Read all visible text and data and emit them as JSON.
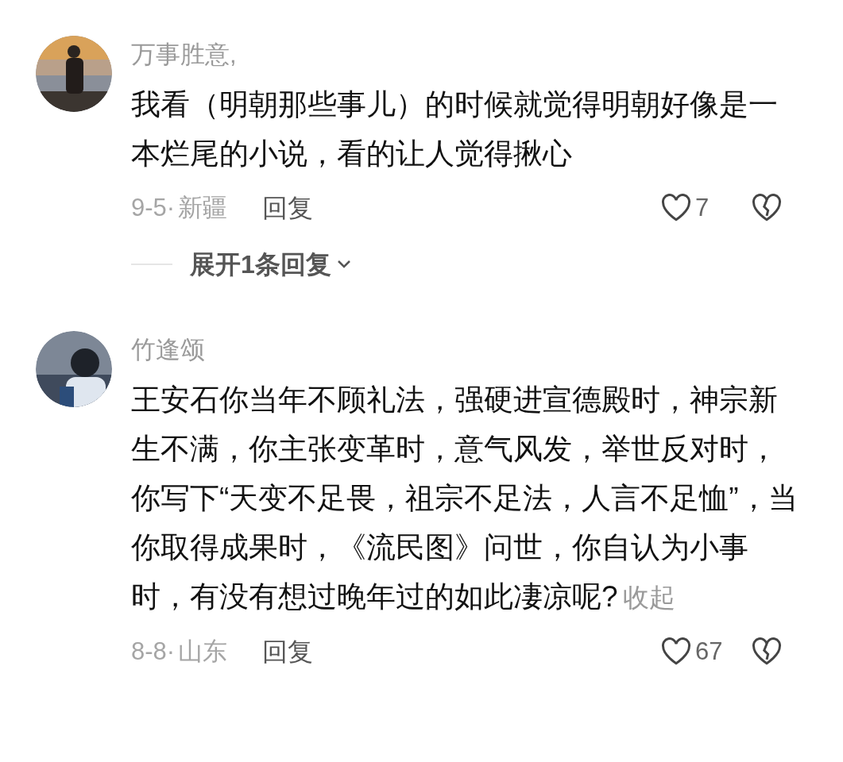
{
  "comments": [
    {
      "author": "万事胜意,",
      "text": "我看（明朝那些事儿）的时候就觉得明朝好像是一本烂尾的小说，看的让人觉得揪心",
      "date": "9-5·",
      "location": "新疆",
      "reply": "回复",
      "likes": "7",
      "expand_replies": "展开1条回复"
    },
    {
      "author": "竹逢颂",
      "text": "王安石你当年不顾礼法，强硬进宣德殿时，神宗新生不满，你主张变革时，意气风发，举世反对时，你写下“天变不足畏，祖宗不足法，人言不足恤”，当你取得成果时，《流民图》问世，你自认为小事时，有没有想过晚年过的如此凄凉呢?",
      "collapse": "收起",
      "date": "8-8·",
      "location": "山东",
      "reply": "回复",
      "likes": "67"
    }
  ]
}
